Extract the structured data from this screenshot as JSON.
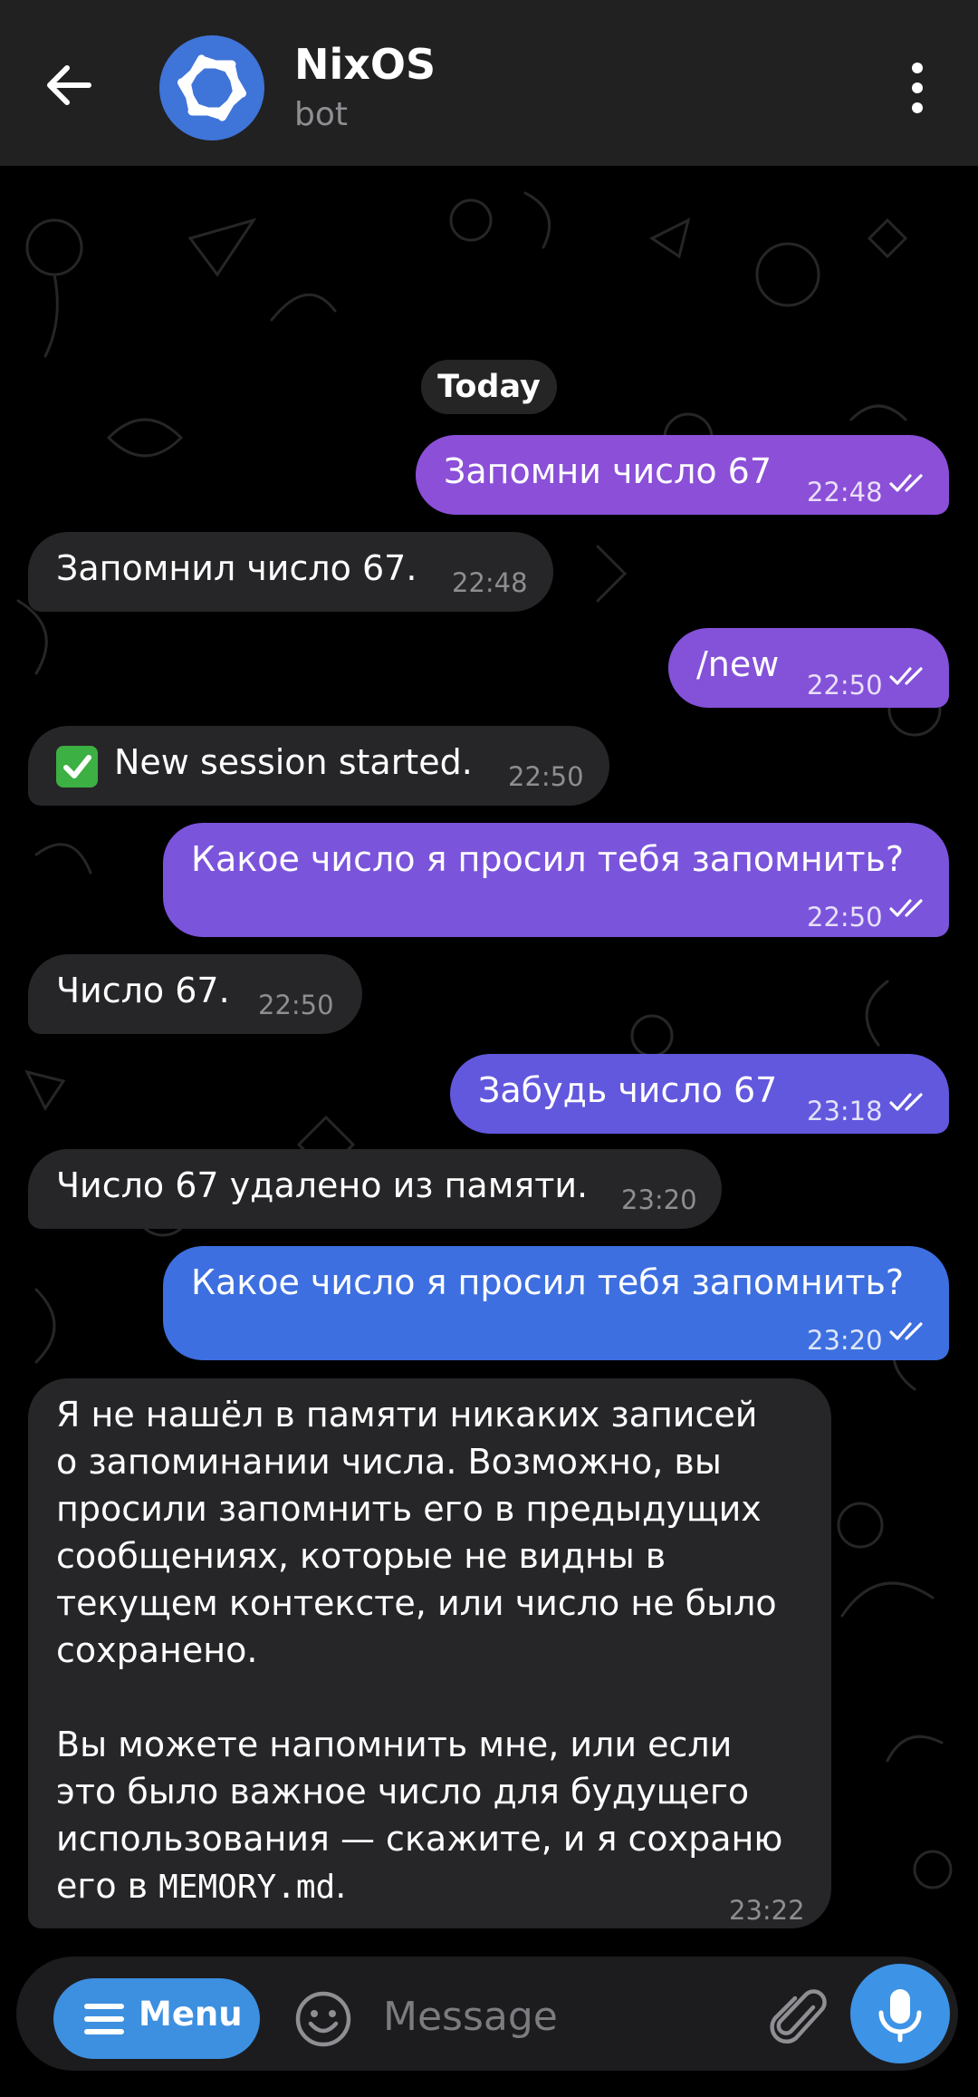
{
  "header": {
    "title": "NixOS",
    "subtitle": "bot",
    "back_icon": "arrow-left-icon",
    "menu_icon": "more-vertical-icon",
    "avatar_color": "#3f74d8"
  },
  "chat": {
    "date_label": "Today",
    "messages": [
      {
        "side": "out",
        "text": "Запомни число 67",
        "time": "22:48",
        "read": true
      },
      {
        "side": "in",
        "text": "Запомнил число 67.",
        "time": "22:48"
      },
      {
        "side": "out",
        "text": "/new",
        "time": "22:50",
        "read": true
      },
      {
        "side": "in",
        "emoji": "✅",
        "text": "New session started.",
        "time": "22:50"
      },
      {
        "side": "out",
        "text": "Какое число я просил тебя запомнить?",
        "time": "22:50",
        "read": true
      },
      {
        "side": "in",
        "text": "Число 67.",
        "time": "22:50"
      },
      {
        "side": "out",
        "text": "Забудь число 67",
        "time": "23:18",
        "read": true
      },
      {
        "side": "in",
        "text": "Число 67 удалено из памяти.",
        "time": "23:20"
      },
      {
        "side": "out",
        "text": "Какое число я просил тебя запомнить?",
        "time": "23:20",
        "read": true
      },
      {
        "side": "in",
        "paragraph1": "Я не нашёл в памяти никаких записей\nо запоминании числа. Возможно, вы\nпросили запомнить его в предыдущих\nсообщениях, которые не видны в\nтекущем контексте, или число не было\nсохранено.",
        "paragraph2": "Вы можете напомнить мне, или если\nэто было важное число для будущего\nиспользования — скажите, и я сохраню\nего в ",
        "code": "MEMORY.md",
        "paragraph2_end": ".",
        "time": "23:22"
      }
    ]
  },
  "composer": {
    "menu_label": "Menu",
    "placeholder": "Message",
    "menu_icon": "hamburger-icon",
    "emoji_icon": "emoji-icon",
    "attach_icon": "paperclip-icon",
    "mic_icon": "microphone-icon"
  },
  "colors": {
    "outgoing_purple": "#8b4fd8",
    "outgoing_blue": "#3d6fe0",
    "incoming": "#262628",
    "accent": "#3d93e6"
  }
}
